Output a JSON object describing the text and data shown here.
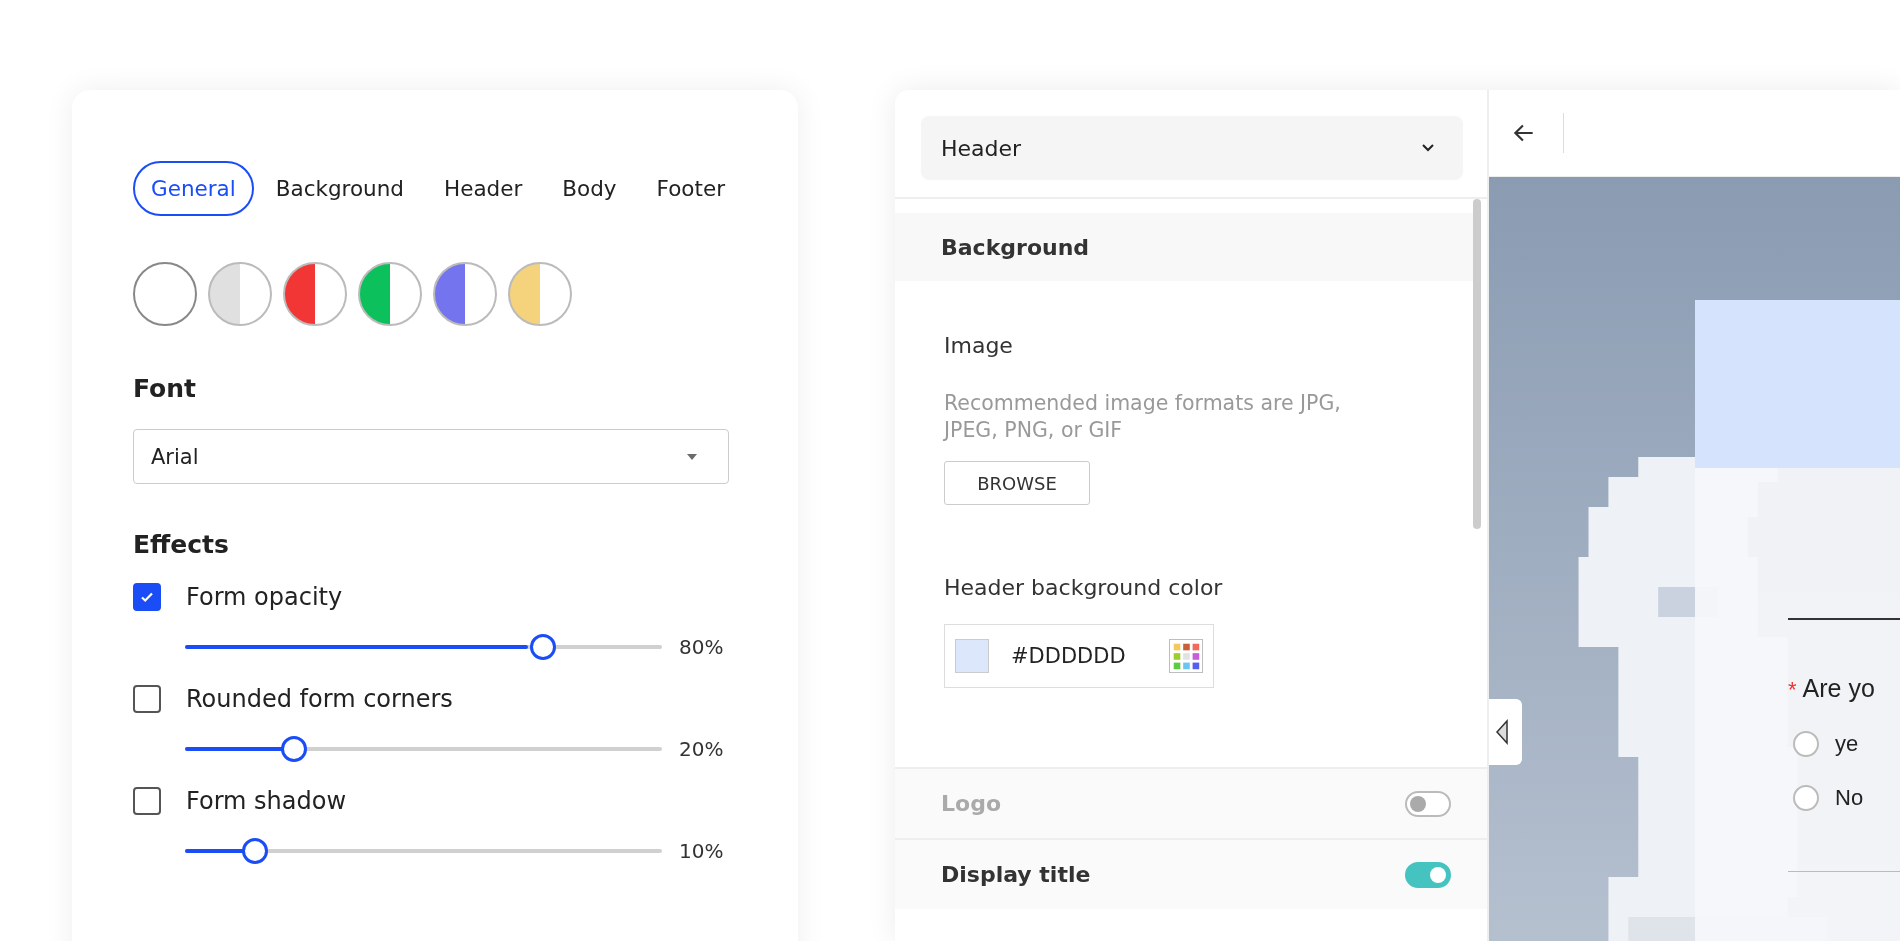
{
  "theme_panel": {
    "tabs": [
      {
        "label": "General",
        "selected": true
      },
      {
        "label": "Background",
        "selected": false
      },
      {
        "label": "Header",
        "selected": false
      },
      {
        "label": "Body",
        "selected": false
      },
      {
        "label": "Footer",
        "selected": false
      }
    ],
    "swatches": [
      {
        "color": "#ffffff",
        "selected": true
      },
      {
        "color": "#e0e0e0",
        "selected": false
      },
      {
        "color": "#f23535",
        "selected": false
      },
      {
        "color": "#0cc05c",
        "selected": false
      },
      {
        "color": "#7474ee",
        "selected": false
      },
      {
        "color": "#f5d27c",
        "selected": false
      }
    ],
    "font": {
      "label": "Font",
      "value": "Arial"
    },
    "effects": {
      "label": "Effects",
      "items": [
        {
          "label": "Form opacity",
          "checked": true,
          "level": 0.72,
          "reading": "80%"
        },
        {
          "label": "Rounded form corners",
          "checked": false,
          "level": 0.22,
          "reading": "20%"
        },
        {
          "label": "Form shadow",
          "checked": false,
          "level": 0.14,
          "reading": "10%"
        }
      ]
    }
  },
  "editor": {
    "section_select": "Header",
    "section_title": "Background",
    "image": {
      "label": "Image",
      "hint": "Recommended image formats are JPG, JPEG, PNG, or GIF",
      "button": "BROWSE"
    },
    "color": {
      "label": "Header background color",
      "value": "#DDDDDD"
    },
    "toggles": [
      {
        "label": "Logo",
        "on": false
      },
      {
        "label": "Display title",
        "on": true
      }
    ],
    "preview": {
      "required_mark": "*",
      "question": "Are yo",
      "options": [
        {
          "label": "ye",
          "selected": false
        },
        {
          "label": "No",
          "selected": false
        }
      ]
    }
  }
}
